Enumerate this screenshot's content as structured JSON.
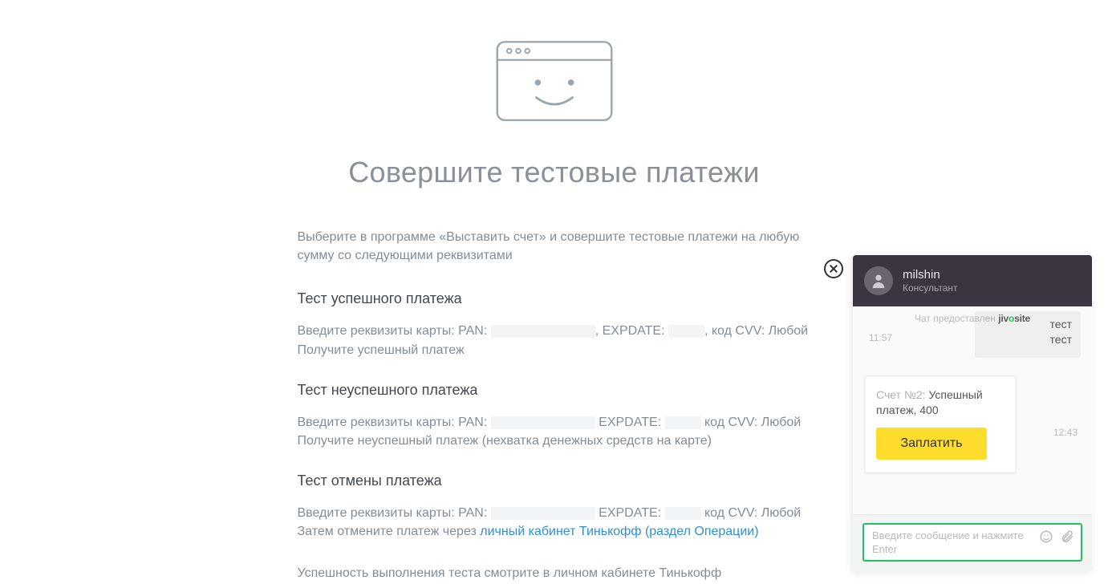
{
  "page": {
    "title": "Совершите тестовые платежи",
    "intro": "Выберите в программе «Выставить счет» и совершите тестовые платежи на любую сумму со следующими реквизитами",
    "sections": [
      {
        "heading": "Тест успешного платежа",
        "line1_prefix": "Введите реквизиты карты: PAN: ",
        "line1_mid": ", EXPDATE: ",
        "line1_suffix": ", код CVV: Любой",
        "line2": "Получите успешный платеж"
      },
      {
        "heading": "Тест неуспешного платежа",
        "line1_prefix": "Введите реквизиты карты: PAN: ",
        "line1_mid": " EXPDATE: ",
        "line1_suffix": " код CVV: Любой",
        "line2": "Получите неуспешный платеж (нехватка денежных средств на карте)"
      },
      {
        "heading": "Тест отмены платежа",
        "line1_prefix": "Введите реквизиты карты: PAN: ",
        "line1_mid": " EXPDATE: ",
        "line1_suffix": " код CVV: Любой",
        "line2_prefix": "Затем отмените платеж через ",
        "line2_link": "личный кабинет Тинькофф (раздел Операции)"
      }
    ],
    "footer_note": "Успешность выполнения теста смотрите в личном кабинете Тинькофф"
  },
  "chat": {
    "agent_name": "milshin",
    "agent_role": "Консультант",
    "provider_prefix": "Чат предоставлен ",
    "provider_brand": "jivosite",
    "incoming": {
      "time": "11:57",
      "lines": [
        "тест",
        "тест"
      ]
    },
    "card": {
      "label_muted": "Счет №2: ",
      "label_rest": "Успешный платеж, 400",
      "button": "Заплатить",
      "time": "12:43"
    },
    "input": {
      "placeholder": "Введите сообщение и нажмите Enter"
    }
  }
}
